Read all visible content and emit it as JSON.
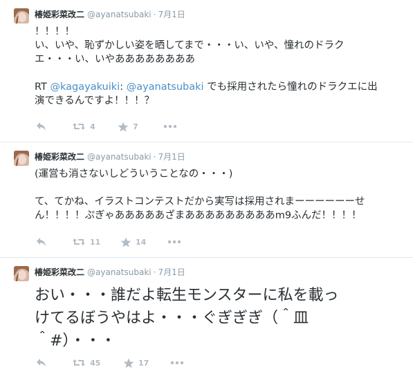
{
  "tweets": [
    {
      "fullname": "椿姫彩菜改二",
      "username": "@ayanatsubaki",
      "separator": "·",
      "time": "7月1日",
      "lines": [
        "！！！！",
        "い、いや、恥ずかしい姿を晒してまで・・・い、いや、憧れのドラク",
        "エ・・・い、いやああああああああ",
        "",
        "RT "
      ],
      "rt_mention1": "@kagayakuiki",
      "rt_colon": ": ",
      "rt_mention2": "@ayanatsubaki",
      "rt_rest": " でも採用されたら憧れのドラクエに出",
      "rt_line2": "演できるんですよ！！！？",
      "retweets": "4",
      "favorites": "7"
    },
    {
      "fullname": "椿姫彩菜改二",
      "username": "@ayanatsubaki",
      "separator": "·",
      "time": "7月1日",
      "lines": [
        "(運営も消さないしどういうことなの・・・)",
        "",
        "て、てかね、イラストコンテストだから実写は採用されまーーーーーーせ",
        "ん！！！！ぷぎゃあああああざまあああああああああm9ふんだ！！！！"
      ],
      "retweets": "11",
      "favorites": "14"
    },
    {
      "fullname": "椿姫彩菜改二",
      "username": "@ayanatsubaki",
      "separator": "·",
      "time": "7月1日",
      "lines": [
        "おい・・・誰だよ転生モンスターに私を載っ",
        "けてるぼうやはよ・・・ぐぎぎぎ（＾皿",
        "＾#）・・・"
      ],
      "retweets": "45",
      "favorites": "17"
    }
  ],
  "icons": {
    "reply": "reply-icon",
    "retweet": "retweet-icon",
    "favorite": "star-icon",
    "more": "more-icon"
  },
  "colors": {
    "name": "#292f33",
    "meta": "#8899a6",
    "link": "#4a8fc6",
    "action": "#b3bcc4",
    "divider": "#e1e8ed"
  }
}
